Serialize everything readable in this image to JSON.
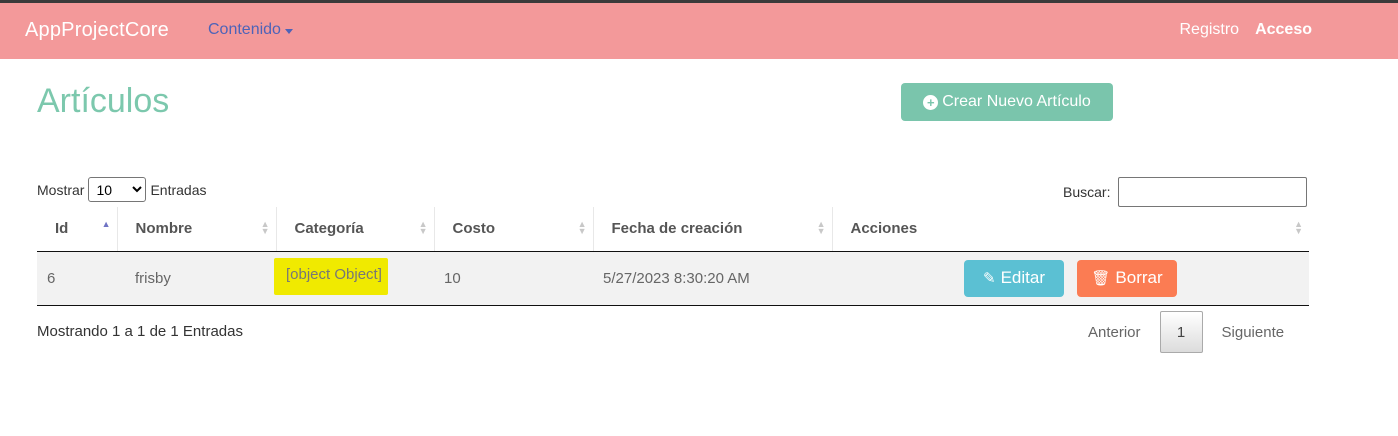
{
  "navbar": {
    "brand": "AppProjectCore",
    "dropdown_label": "Contenido",
    "links": {
      "register": "Registro",
      "login": "Acceso"
    }
  },
  "main": {
    "title": "Artículos",
    "create_button": "Crear Nuevo Artículo"
  },
  "table_controls": {
    "show_label": "Mostrar",
    "page_size": "10",
    "entries_label": "Entradas",
    "search_label": "Buscar:",
    "search_value": ""
  },
  "table": {
    "columns": [
      "Id",
      "Nombre",
      "Categoría",
      "Costo",
      "Fecha de creación",
      "Acciones"
    ],
    "rows": [
      {
        "id": "6",
        "nombre": "frisby",
        "categoria": "[object Object]",
        "costo": "10",
        "fecha": "5/27/2023 8:30:20 AM"
      }
    ],
    "edit_label": "Editar",
    "delete_label": "Borrar"
  },
  "footer": {
    "info": "Mostrando 1 a 1 de 1 Entradas",
    "prev": "Anterior",
    "current_page": "1",
    "next": "Siguiente"
  },
  "colors": {
    "navbar": "#f3999a",
    "title": "#7cc8ad",
    "create_button": "#7ac5ac",
    "edit_button": "#5bc0d3",
    "delete_button": "#fb7c53",
    "highlight": "#f0ea00"
  }
}
